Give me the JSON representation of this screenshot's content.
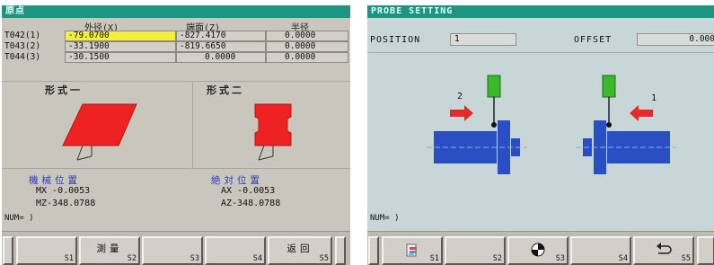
{
  "left": {
    "title": "原点",
    "headers": {
      "col1": "外径(X)",
      "col2": "端面(Z)",
      "col3": "半径"
    },
    "rows": [
      {
        "tool": "T042(1)",
        "x": "-79.0700",
        "z": "-827.4170",
        "r": "0.0000"
      },
      {
        "tool": "T043(2)",
        "x": "-33.1900",
        "z": "-819.6650",
        "r": "0.0000"
      },
      {
        "tool": "T044(3)",
        "x": "-30.1500",
        "z": "0.0000",
        "r": "0.0000"
      }
    ],
    "form1": "形式一",
    "form2": "形式二",
    "machine_pos": {
      "title": "機械位置",
      "mx": "MX   -0.0053",
      "mz": "MZ-348.0788"
    },
    "abs_pos": {
      "title": "絶対位置",
      "ax": "AX   -0.0053",
      "az": "AZ-348.0788"
    },
    "num": "NUM= )",
    "softkeys": [
      {
        "num": "S1",
        "label": ""
      },
      {
        "num": "S2",
        "label": "測量"
      },
      {
        "num": "S3",
        "label": ""
      },
      {
        "num": "S4",
        "label": ""
      },
      {
        "num": "S5",
        "label": "返回"
      }
    ]
  },
  "right": {
    "title": "PROBE SETTING",
    "position_label": "POSITION",
    "position_value": "1",
    "offset_label": "OFFSET",
    "offset_value": "0.000",
    "probe_label_left": "2",
    "probe_label_right": "1",
    "num": "NUM= )",
    "softkeys": [
      {
        "num": "S1",
        "icon": "document-icon"
      },
      {
        "num": "S2",
        "icon": ""
      },
      {
        "num": "S3",
        "icon": "target-icon"
      },
      {
        "num": "S4",
        "icon": ""
      },
      {
        "num": "S5",
        "icon": "return-arrow-icon"
      }
    ]
  },
  "colors": {
    "titlebar": "#1c9683",
    "selected_cell": "#f2ee3b",
    "tool_shape": "#ee2222",
    "probe_body": "#3cb82c",
    "workpiece": "#2a4fc4",
    "arrow": "#e32b2b",
    "position_title": "#2a3fb0"
  }
}
